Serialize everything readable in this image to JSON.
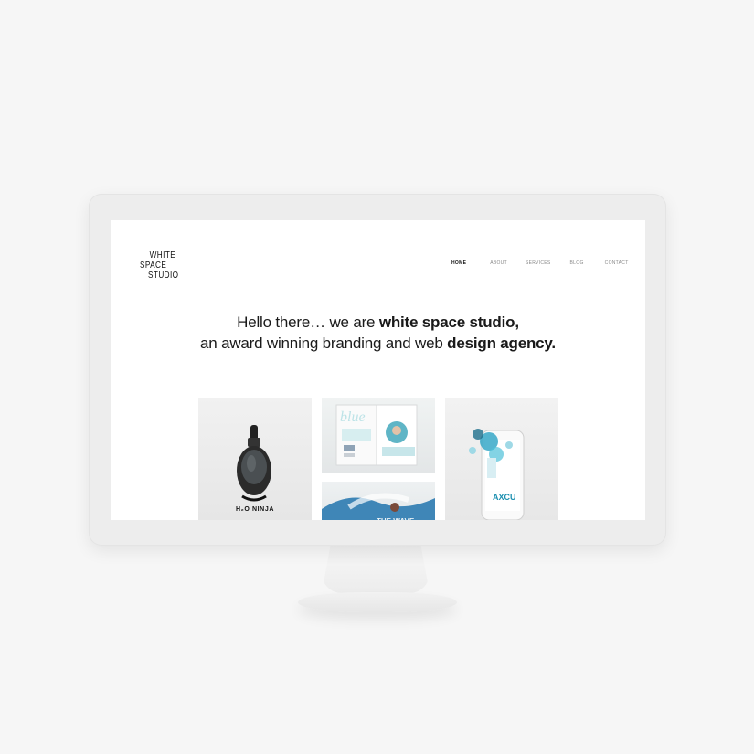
{
  "logo": {
    "line1": "WHITE",
    "line2": "SPACE",
    "line3": "STUDIO"
  },
  "nav": {
    "items": [
      {
        "label": "HOME",
        "active": true
      },
      {
        "label": "ABOUT",
        "active": false
      },
      {
        "label": "SERVICES",
        "active": false
      },
      {
        "label": "BLOG",
        "active": false
      },
      {
        "label": "CONTACT",
        "active": false
      }
    ]
  },
  "hero": {
    "line1_regular": "Hello there… we are ",
    "line1_bold": "white space studio,",
    "line2_regular": "an award winning branding and web ",
    "line2_bold": "design agency."
  },
  "portfolio": {
    "tiles": [
      {
        "name": "snorkel-mask-project",
        "caption": "H₂O NINJA"
      },
      {
        "name": "magazine-project",
        "caption": ""
      },
      {
        "name": "surf-project",
        "caption": ""
      },
      {
        "name": "app-project",
        "caption": "AXCU"
      }
    ]
  },
  "colors": {
    "background": "#f6f6f6",
    "monitor": "#ededed",
    "screen": "#ffffff",
    "accent": "#1b8fb0"
  }
}
